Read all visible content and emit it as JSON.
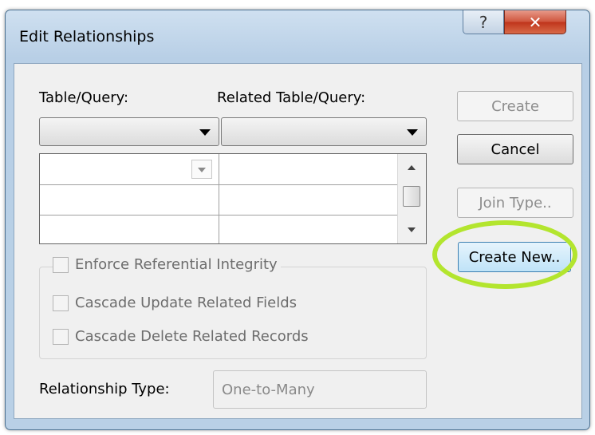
{
  "window": {
    "title": "Edit Relationships"
  },
  "titlebar": {
    "help_glyph": "?",
    "close_glyph": "✕"
  },
  "labels": {
    "table_query": "Table/Query:",
    "related_table_query": "Related Table/Query:",
    "relationship_type": "Relationship Type:"
  },
  "fields": {
    "table_query_value": "",
    "related_table_query_value": "",
    "relationship_type_value": "One-to-Many"
  },
  "options": {
    "enforce": "Enforce Referential Integrity",
    "cascade_update": "Cascade Update Related Fields",
    "cascade_delete": "Cascade Delete Related Records"
  },
  "buttons": {
    "create": "Create",
    "cancel": "Cancel",
    "join_type": "Join Type..",
    "create_new": "Create New.."
  },
  "colors": {
    "highlight_ring": "#b3e52e",
    "close_button": "#c9452a",
    "titlebar": "#b9d0e6"
  },
  "icons": [
    "help-icon",
    "close-icon",
    "chevron-down-icon",
    "scroll-up-icon",
    "scroll-down-icon"
  ]
}
